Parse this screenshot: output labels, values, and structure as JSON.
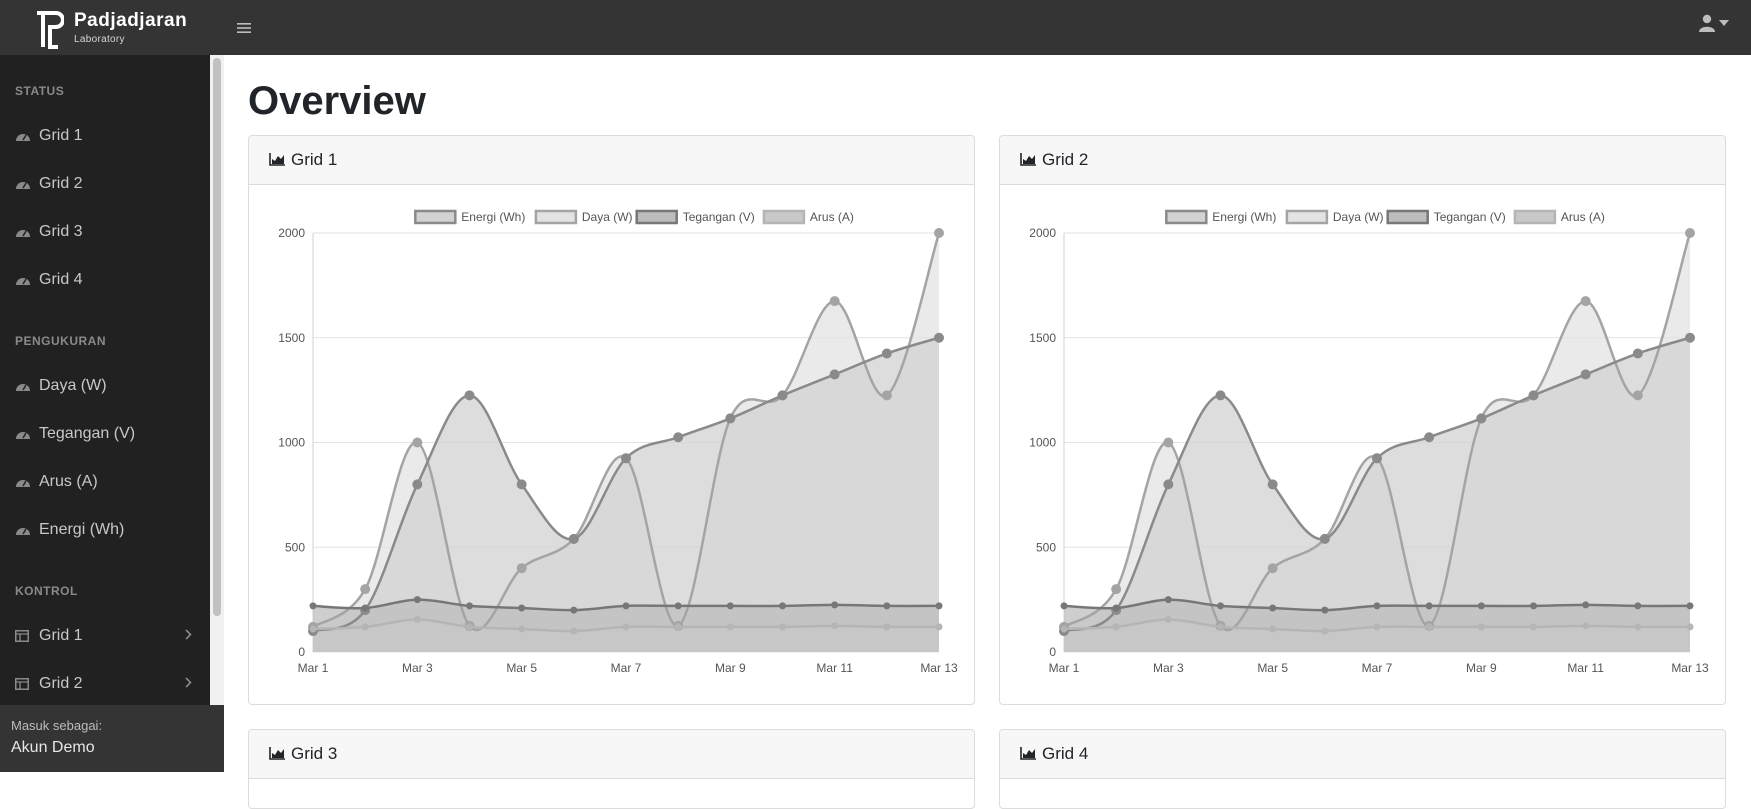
{
  "brand": {
    "name": "Padjadjaran",
    "sub": "Laboratory"
  },
  "icons": {
    "menu": "hamburger-icon",
    "user": "user-icon",
    "gauge": "tachometer-icon",
    "chart": "area-chart-icon",
    "table": "table-icon"
  },
  "sidebar": {
    "headings": {
      "status": "STATUS",
      "pengukuran": "PENGUKURAN",
      "kontrol": "KONTROL"
    },
    "status_items": [
      "Grid 1",
      "Grid 2",
      "Grid 3",
      "Grid 4"
    ],
    "pengukuran_items": [
      "Daya (W)",
      "Tegangan (V)",
      "Arus (A)",
      "Energi (Wh)"
    ],
    "kontrol_items": [
      "Grid 1",
      "Grid 2"
    ],
    "footer": {
      "label": "Masuk sebagai:",
      "user": "Akun Demo"
    }
  },
  "main": {
    "title": "Overview",
    "cards": [
      {
        "title": "Grid 1"
      },
      {
        "title": "Grid 2"
      },
      {
        "title": "Grid 3"
      },
      {
        "title": "Grid 4"
      }
    ]
  },
  "chart_data": [
    {
      "type": "line",
      "title": "Grid 1",
      "x": [
        "Mar 1",
        "Mar 2",
        "Mar 3",
        "Mar 4",
        "Mar 5",
        "Mar 6",
        "Mar 7",
        "Mar 8",
        "Mar 9",
        "Mar 10",
        "Mar 11",
        "Mar 12",
        "Mar 13"
      ],
      "x_tick_labels": [
        "Mar 1",
        "Mar 3",
        "Mar 5",
        "Mar 7",
        "Mar 9",
        "Mar 11",
        "Mar 13"
      ],
      "ylim": [
        0,
        2000
      ],
      "y_ticks": [
        0,
        500,
        1000,
        1500,
        2000
      ],
      "legend": "top",
      "grid": true,
      "series": [
        {
          "name": "Energi (Wh)",
          "values": [
            100,
            200,
            800,
            1225,
            800,
            540,
            925,
            1025,
            1115,
            1225,
            1325,
            1425,
            1500
          ],
          "color": "#8a8a8a",
          "fill": "#d2d2d2"
        },
        {
          "name": "Daya (W)",
          "values": [
            120,
            300,
            1000,
            125,
            400,
            540,
            925,
            125,
            1115,
            1225,
            1675,
            1225,
            2000
          ],
          "color": "#a4a4a4",
          "fill": "#e3e3e3"
        },
        {
          "name": "Tegangan (V)",
          "values": [
            220,
            210,
            250,
            220,
            210,
            200,
            220,
            220,
            220,
            220,
            225,
            220,
            220
          ],
          "color": "#777777",
          "fill": "#bdbdbd"
        },
        {
          "name": "Arus (A)",
          "values": [
            110,
            120,
            155,
            120,
            110,
            100,
            120,
            120,
            120,
            120,
            125,
            120,
            120
          ],
          "color": "#b5b5b5",
          "fill": "#c8c8c8"
        }
      ]
    },
    {
      "type": "line",
      "title": "Grid 2",
      "x": [
        "Mar 1",
        "Mar 2",
        "Mar 3",
        "Mar 4",
        "Mar 5",
        "Mar 6",
        "Mar 7",
        "Mar 8",
        "Mar 9",
        "Mar 10",
        "Mar 11",
        "Mar 12",
        "Mar 13"
      ],
      "x_tick_labels": [
        "Mar 1",
        "Mar 3",
        "Mar 5",
        "Mar 7",
        "Mar 9",
        "Mar 11",
        "Mar 13"
      ],
      "ylim": [
        0,
        2000
      ],
      "y_ticks": [
        0,
        500,
        1000,
        1500,
        2000
      ],
      "legend": "top",
      "grid": true,
      "series": [
        {
          "name": "Energi (Wh)",
          "values": [
            100,
            200,
            800,
            1225,
            800,
            540,
            925,
            1025,
            1115,
            1225,
            1325,
            1425,
            1500
          ],
          "color": "#8a8a8a",
          "fill": "#d2d2d2"
        },
        {
          "name": "Daya (W)",
          "values": [
            120,
            300,
            1000,
            125,
            400,
            540,
            925,
            125,
            1115,
            1225,
            1675,
            1225,
            2000
          ],
          "color": "#a4a4a4",
          "fill": "#e3e3e3"
        },
        {
          "name": "Tegangan (V)",
          "values": [
            220,
            210,
            250,
            220,
            210,
            200,
            220,
            220,
            220,
            220,
            225,
            220,
            220
          ],
          "color": "#777777",
          "fill": "#bdbdbd"
        },
        {
          "name": "Arus (A)",
          "values": [
            110,
            120,
            155,
            120,
            110,
            100,
            120,
            120,
            120,
            120,
            125,
            120,
            120
          ],
          "color": "#b5b5b5",
          "fill": "#c8c8c8"
        }
      ]
    }
  ]
}
